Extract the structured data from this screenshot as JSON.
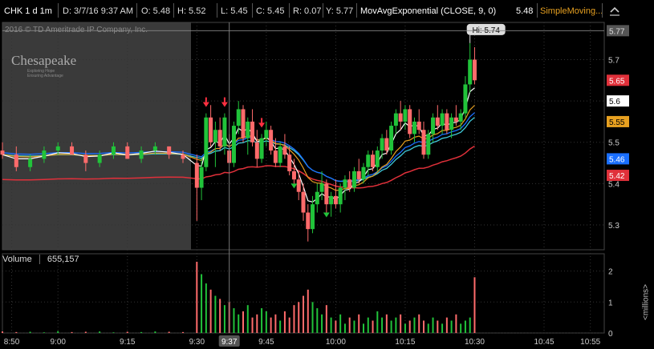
{
  "header": {
    "symbol": "CHK 1 d 1m",
    "date": "D: 3/7/16 9:37 AM",
    "open": "O: 5.48",
    "high": "H: 5.52",
    "low": "L: 5.45",
    "close": "C: 5.45",
    "range": "R: 0.07",
    "y": "Y: 5.77",
    "study1": "MovAvgExponential (CLOSE, 9, 0)",
    "study1_value": "5.48",
    "study2": "SimpleMoving...",
    "study1_color": "#ffffff",
    "study2_color": "#e7a020"
  },
  "watermark": {
    "copyright": "2016 © TD Ameritrade IP Company, Inc.",
    "logo": "Chesapeake",
    "logo_sub1": "Exploring Hope",
    "logo_sub2": "Ensuring Advantage"
  },
  "volume_panel": {
    "label": "Volume",
    "value": "655,157",
    "unit_label": "<millions>",
    "ticks": [
      "2",
      "1",
      "0"
    ]
  },
  "price_axis": {
    "ticks": [
      "5.7",
      "5.6",
      "5.5",
      "5.4",
      "5.3"
    ],
    "last_badge": "5.77",
    "badges": [
      {
        "label": "5.65",
        "bg": "#e0303a",
        "fg": "#ffffff"
      },
      {
        "label": "5.6",
        "bg": "#ffffff",
        "fg": "#000000"
      },
      {
        "label": "5.55",
        "bg": "#e7a020",
        "fg": "#000000"
      },
      {
        "label": "5.46",
        "bg": "#1a6fff",
        "fg": "#ffffff"
      },
      {
        "label": "5.42",
        "bg": "#e0303a",
        "fg": "#ffffff"
      }
    ]
  },
  "time_axis": {
    "ticks": [
      "8:50",
      "9:00",
      "9:15",
      "9:30",
      "9:45",
      "10:00",
      "10:15",
      "10:30",
      "10:45",
      "10:55"
    ],
    "cursor_label": "9:37"
  },
  "hi_label": "Hi: 5.74",
  "chart_data": {
    "type": "candlestick",
    "symbol": "CHK",
    "interval": "1m",
    "ylim": [
      5.24,
      5.79
    ],
    "xlim": [
      "8:48",
      "10:58"
    ],
    "premarket_end": "9:30",
    "crosshair_time": "9:37",
    "candles": [
      [
        "8:48",
        5.48,
        5.5,
        5.46,
        5.47
      ],
      [
        "8:51",
        5.47,
        5.49,
        5.43,
        5.44
      ],
      [
        "8:54",
        5.44,
        5.47,
        5.43,
        5.46
      ],
      [
        "8:57",
        5.46,
        5.49,
        5.45,
        5.48
      ],
      [
        "9:00",
        5.48,
        5.5,
        5.47,
        5.49
      ],
      [
        "9:03",
        5.49,
        5.5,
        5.47,
        5.47
      ],
      [
        "9:06",
        5.47,
        5.48,
        5.43,
        5.45
      ],
      [
        "9:09",
        5.45,
        5.48,
        5.44,
        5.47
      ],
      [
        "9:12",
        5.47,
        5.5,
        5.46,
        5.49
      ],
      [
        "9:15",
        5.49,
        5.5,
        5.46,
        5.46
      ],
      [
        "9:18",
        5.46,
        5.49,
        5.45,
        5.48
      ],
      [
        "9:21",
        5.48,
        5.5,
        5.47,
        5.49
      ],
      [
        "9:24",
        5.49,
        5.49,
        5.46,
        5.47
      ],
      [
        "9:27",
        5.47,
        5.48,
        5.45,
        5.46
      ],
      [
        "9:30",
        5.45,
        5.47,
        5.31,
        5.39
      ],
      [
        "9:31",
        5.39,
        5.46,
        5.36,
        5.44
      ],
      [
        "9:32",
        5.44,
        5.57,
        5.43,
        5.56
      ],
      [
        "9:33",
        5.56,
        5.59,
        5.49,
        5.5
      ],
      [
        "9:34",
        5.5,
        5.55,
        5.44,
        5.53
      ],
      [
        "9:35",
        5.53,
        5.56,
        5.48,
        5.49
      ],
      [
        "9:36",
        5.49,
        5.57,
        5.47,
        5.56
      ],
      [
        "9:37",
        5.48,
        5.52,
        5.45,
        5.45
      ],
      [
        "9:38",
        5.45,
        5.55,
        5.44,
        5.54
      ],
      [
        "9:39",
        5.54,
        5.6,
        5.52,
        5.58
      ],
      [
        "9:40",
        5.58,
        5.59,
        5.5,
        5.51
      ],
      [
        "9:41",
        5.51,
        5.56,
        5.47,
        5.55
      ],
      [
        "9:42",
        5.55,
        5.58,
        5.49,
        5.5
      ],
      [
        "9:43",
        5.5,
        5.53,
        5.44,
        5.46
      ],
      [
        "9:44",
        5.46,
        5.52,
        5.45,
        5.51
      ],
      [
        "9:45",
        5.51,
        5.55,
        5.49,
        5.53
      ],
      [
        "9:46",
        5.53,
        5.54,
        5.47,
        5.48
      ],
      [
        "9:47",
        5.48,
        5.51,
        5.44,
        5.45
      ],
      [
        "9:48",
        5.45,
        5.5,
        5.44,
        5.49
      ],
      [
        "9:49",
        5.49,
        5.52,
        5.46,
        5.47
      ],
      [
        "9:50",
        5.47,
        5.49,
        5.42,
        5.43
      ],
      [
        "9:51",
        5.43,
        5.46,
        5.4,
        5.41
      ],
      [
        "9:52",
        5.41,
        5.43,
        5.36,
        5.38
      ],
      [
        "9:53",
        5.38,
        5.4,
        5.31,
        5.33
      ],
      [
        "9:54",
        5.33,
        5.35,
        5.26,
        5.29
      ],
      [
        "9:55",
        5.29,
        5.37,
        5.28,
        5.35
      ],
      [
        "9:56",
        5.35,
        5.4,
        5.33,
        5.38
      ],
      [
        "9:57",
        5.38,
        5.43,
        5.36,
        5.4
      ],
      [
        "9:58",
        5.4,
        5.41,
        5.33,
        5.35
      ],
      [
        "9:59",
        5.35,
        5.38,
        5.32,
        5.37
      ],
      [
        "10:00",
        5.37,
        5.41,
        5.34,
        5.35
      ],
      [
        "10:01",
        5.35,
        5.4,
        5.33,
        5.39
      ],
      [
        "10:02",
        5.39,
        5.42,
        5.36,
        5.41
      ],
      [
        "10:03",
        5.41,
        5.43,
        5.38,
        5.39
      ],
      [
        "10:04",
        5.39,
        5.44,
        5.38,
        5.43
      ],
      [
        "10:05",
        5.43,
        5.46,
        5.4,
        5.41
      ],
      [
        "10:06",
        5.41,
        5.45,
        5.4,
        5.44
      ],
      [
        "10:07",
        5.44,
        5.48,
        5.42,
        5.47
      ],
      [
        "10:08",
        5.47,
        5.48,
        5.43,
        5.44
      ],
      [
        "10:09",
        5.44,
        5.49,
        5.43,
        5.48
      ],
      [
        "10:10",
        5.48,
        5.52,
        5.46,
        5.51
      ],
      [
        "10:11",
        5.51,
        5.53,
        5.47,
        5.48
      ],
      [
        "10:12",
        5.48,
        5.55,
        5.47,
        5.54
      ],
      [
        "10:13",
        5.54,
        5.58,
        5.52,
        5.57
      ],
      [
        "10:14",
        5.57,
        5.6,
        5.53,
        5.55
      ],
      [
        "10:15",
        5.55,
        5.59,
        5.53,
        5.58
      ],
      [
        "10:16",
        5.58,
        5.59,
        5.51,
        5.52
      ],
      [
        "10:17",
        5.52,
        5.56,
        5.5,
        5.55
      ],
      [
        "10:18",
        5.55,
        5.58,
        5.52,
        5.53
      ],
      [
        "10:19",
        5.53,
        5.55,
        5.46,
        5.47
      ],
      [
        "10:20",
        5.47,
        5.53,
        5.46,
        5.52
      ],
      [
        "10:21",
        5.52,
        5.57,
        5.5,
        5.56
      ],
      [
        "10:22",
        5.56,
        5.59,
        5.53,
        5.54
      ],
      [
        "10:23",
        5.54,
        5.58,
        5.52,
        5.57
      ],
      [
        "10:24",
        5.57,
        5.58,
        5.52,
        5.53
      ],
      [
        "10:25",
        5.53,
        5.57,
        5.51,
        5.56
      ],
      [
        "10:26",
        5.56,
        5.59,
        5.54,
        5.55
      ],
      [
        "10:27",
        5.55,
        5.58,
        5.53,
        5.57
      ],
      [
        "10:28",
        5.57,
        5.66,
        5.56,
        5.64
      ],
      [
        "10:29",
        5.64,
        5.74,
        5.62,
        5.7
      ],
      [
        "10:30",
        5.7,
        5.73,
        5.64,
        5.65
      ]
    ],
    "sell_signals": [
      "9:32",
      "9:36",
      "9:44"
    ],
    "buy_signals": [
      "9:51",
      "9:58"
    ],
    "studies": [
      {
        "name": "EMA 9",
        "color": "#ffffff",
        "last": 5.6
      },
      {
        "name": "SMA (orange)",
        "color": "#e7a020",
        "last": 5.55
      },
      {
        "name": "SMA (blue)",
        "color": "#1a6fff",
        "last": 5.46
      },
      {
        "name": "SMA (cyan)",
        "color": "#3fc8d8",
        "last": 5.46
      },
      {
        "name": "SMA (red)",
        "color": "#e0303a",
        "last": 5.42
      }
    ],
    "volume_millions": [
      0.05,
      0.03,
      0.04,
      0.02,
      0.06,
      0.03,
      0.04,
      0.05,
      0.02,
      0.04,
      0.03,
      0.05,
      0.04,
      0.03,
      2.3,
      1.9,
      1.6,
      1.4,
      1.2,
      1.1,
      0.9,
      1.0,
      0.8,
      0.6,
      0.7,
      0.9,
      0.5,
      0.6,
      0.8,
      0.7,
      0.5,
      0.6,
      0.4,
      0.7,
      0.5,
      0.9,
      1.0,
      1.2,
      1.4,
      1.0,
      0.8,
      0.6,
      0.9,
      0.5,
      0.4,
      0.6,
      0.3,
      0.5,
      0.4,
      0.6,
      0.3,
      0.5,
      0.4,
      0.7,
      0.5,
      0.6,
      0.4,
      0.5,
      0.6,
      0.3,
      0.4,
      0.5,
      0.6,
      0.4,
      0.3,
      0.5,
      0.4,
      0.3,
      0.5,
      0.4,
      0.6,
      0.3,
      0.4,
      0.5,
      1.8,
      0.8,
      0.4
    ]
  }
}
